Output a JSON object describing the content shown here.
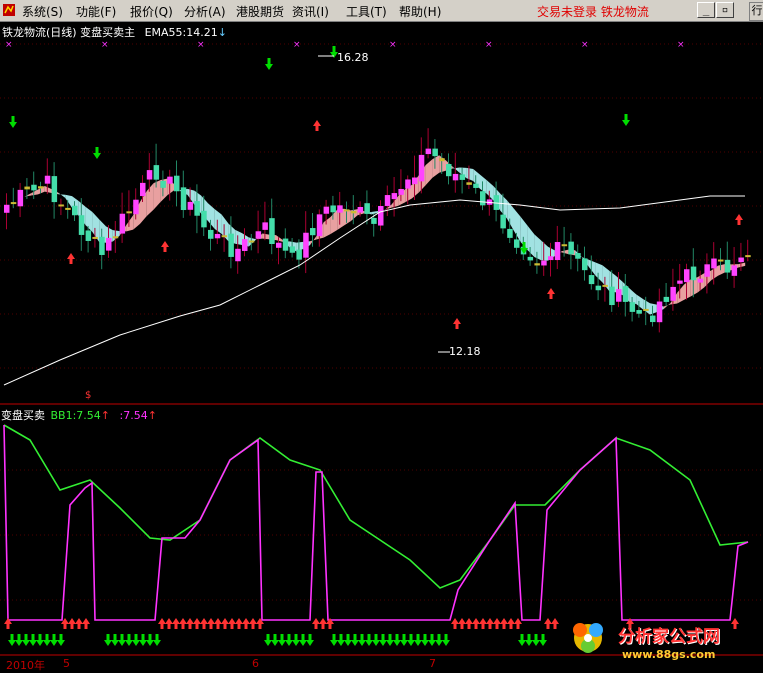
{
  "menu": {
    "items": [
      "系统(S)",
      "功能(F)",
      "报价(Q)",
      "分析(A)",
      "港股期货",
      "资讯(I)",
      "工具(T)",
      "帮助(H)"
    ],
    "status": "交易未登录",
    "stock": "铁龙物流",
    "side_tab": "行"
  },
  "upper": {
    "title": "铁龙物流(日线) 变盘买卖主",
    "ema_label": "EMA55:14.21",
    "ema_arrow": "↓",
    "high_label": "16.28",
    "low_label": "12.18",
    "signal_mark": "$"
  },
  "lower": {
    "name": "变盘买卖",
    "bb1_label": "BB1:7.54",
    "bb1_arrow": "↑",
    "value2": ":7.54",
    "value2_arrow": "↑"
  },
  "date_axis": {
    "year": "2010年",
    "months": [
      "5",
      "6",
      "7"
    ]
  },
  "watermark": {
    "brand": "分析家公式网",
    "url": "www.88gs.com"
  },
  "colors": {
    "up": "#ff44ff",
    "down": "#44ddaa",
    "doji": "#ccbb33",
    "band_bull": "#f4a9a9",
    "band_bear": "#aaeeee",
    "ema": "#ffffff",
    "green_line": "#33ee33",
    "magenta_line": "#ff33ff",
    "buy": "#ff3333",
    "sell": "#00dd00"
  }
}
